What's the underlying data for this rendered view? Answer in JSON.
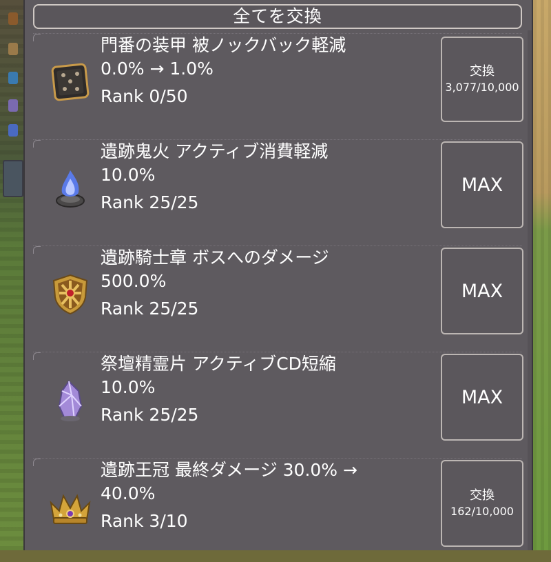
{
  "panel": {
    "title": "全てを交換"
  },
  "items": [
    {
      "name": "門番の装甲 被ノックバック軽減",
      "value": "0.0% → 1.0%",
      "rank": "Rank 0/50",
      "icon": "armor-plate-icon",
      "action": {
        "type": "exchange",
        "label": "交換",
        "cost": "3,077/10,000"
      }
    },
    {
      "name": "遺跡鬼火 アクティブ消費軽減",
      "value": "10.0%",
      "rank": "Rank 25/25",
      "icon": "blue-flame-icon",
      "action": {
        "type": "max",
        "label": "MAX"
      }
    },
    {
      "name": "遺跡騎士章 ボスへのダメージ",
      "value": "500.0%",
      "rank": "Rank 25/25",
      "icon": "knight-shield-icon",
      "action": {
        "type": "max",
        "label": "MAX"
      }
    },
    {
      "name": "祭壇精霊片 アクティブCD短縮",
      "value": "10.0%",
      "rank": "Rank 25/25",
      "icon": "purple-crystal-icon",
      "action": {
        "type": "max",
        "label": "MAX"
      }
    },
    {
      "name": "遺跡王冠 最終ダメージ 30.0% →",
      "value": "40.0%",
      "rank": "Rank 3/10",
      "icon": "gold-crown-icon",
      "action": {
        "type": "exchange",
        "label": "交換",
        "cost": "162/10,000"
      }
    }
  ],
  "colors": {
    "panel_bg": "#5e5a5f",
    "text": "#ffffff",
    "button_border": "#bcb6b3"
  }
}
